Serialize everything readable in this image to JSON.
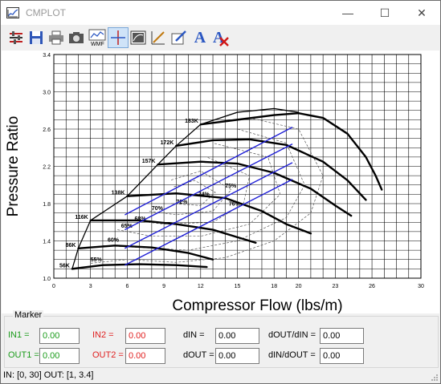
{
  "window": {
    "title": "CMPLOT",
    "minimize": "—",
    "maximize": "☐",
    "close": "✕"
  },
  "toolbar": {
    "items": [
      {
        "name": "settings-icon"
      },
      {
        "name": "save-icon"
      },
      {
        "name": "print-icon"
      },
      {
        "name": "camera-icon"
      },
      {
        "name": "wmf-export-icon",
        "caption": "WMF"
      },
      {
        "name": "crosshair-icon",
        "active": true
      },
      {
        "name": "map-image-icon"
      },
      {
        "name": "line-draw-icon"
      },
      {
        "name": "edit-icon"
      },
      {
        "name": "font-icon",
        "caption": "A"
      },
      {
        "name": "clear-font-icon",
        "caption": "A"
      }
    ]
  },
  "chart_data": {
    "type": "line",
    "xlabel": "Compressor Flow (lbs/m)",
    "ylabel": "Pressure Ratio",
    "xlim": [
      0,
      30
    ],
    "ylim": [
      1.0,
      3.4
    ],
    "x_ticks": [
      "0",
      "3",
      "6",
      "9",
      "12",
      "15",
      "18",
      "20",
      "23",
      "26",
      "30"
    ],
    "y_ticks": [
      "1.0",
      "1.4",
      "1.8",
      "2.2",
      "2.6",
      "3.0",
      "3.4"
    ],
    "grid": true,
    "speed_lines": [
      {
        "label": "56K",
        "points": [
          [
            1.5,
            1.1
          ],
          [
            4,
            1.14
          ],
          [
            7,
            1.15
          ],
          [
            10,
            1.14
          ],
          [
            12.5,
            1.12
          ]
        ]
      },
      {
        "label": "86K",
        "points": [
          [
            2,
            1.32
          ],
          [
            5,
            1.35
          ],
          [
            8,
            1.33
          ],
          [
            11,
            1.27
          ],
          [
            13,
            1.2
          ]
        ]
      },
      {
        "label": "116K",
        "points": [
          [
            3,
            1.62
          ],
          [
            7,
            1.62
          ],
          [
            10,
            1.58
          ],
          [
            13,
            1.52
          ],
          [
            15,
            1.44
          ],
          [
            16.5,
            1.38
          ]
        ]
      },
      {
        "label": "138K",
        "points": [
          [
            6,
            1.88
          ],
          [
            10,
            1.91
          ],
          [
            14,
            1.86
          ],
          [
            17,
            1.72
          ],
          [
            19,
            1.58
          ],
          [
            21,
            1.48
          ]
        ]
      },
      {
        "label": "157K",
        "points": [
          [
            8.5,
            2.22
          ],
          [
            12,
            2.25
          ],
          [
            15,
            2.23
          ],
          [
            18,
            2.13
          ],
          [
            21,
            1.96
          ],
          [
            23,
            1.78
          ],
          [
            24.3,
            1.67
          ]
        ]
      },
      {
        "label": "172K",
        "points": [
          [
            10,
            2.42
          ],
          [
            13,
            2.48
          ],
          [
            16,
            2.49
          ],
          [
            19,
            2.43
          ],
          [
            22,
            2.25
          ],
          [
            24,
            2.05
          ],
          [
            25.5,
            1.84
          ]
        ]
      },
      {
        "label": "183K",
        "points": [
          [
            12,
            2.65
          ],
          [
            15,
            2.7
          ],
          [
            18,
            2.75
          ],
          [
            20,
            2.77
          ],
          [
            22,
            2.72
          ],
          [
            24,
            2.55
          ],
          [
            25.5,
            2.3
          ],
          [
            26.3,
            2.1
          ],
          [
            26.8,
            1.95
          ]
        ]
      }
    ],
    "surge_line": [
      [
        1.5,
        1.1
      ],
      [
        2,
        1.32
      ],
      [
        3,
        1.62
      ],
      [
        6,
        1.88
      ],
      [
        8.5,
        2.22
      ],
      [
        10,
        2.42
      ],
      [
        12,
        2.65
      ],
      [
        15,
        2.78
      ],
      [
        18,
        2.82
      ],
      [
        20,
        2.78
      ]
    ],
    "efficiency_labels": [
      {
        "label": "55%",
        "x": 3.0,
        "y": 1.18
      },
      {
        "label": "60%",
        "x": 4.4,
        "y": 1.39
      },
      {
        "label": "65%",
        "x": 5.5,
        "y": 1.54
      },
      {
        "label": "68%",
        "x": 6.6,
        "y": 1.62
      },
      {
        "label": "70%",
        "x": 8.0,
        "y": 1.73
      },
      {
        "label": "72%",
        "x": 10.0,
        "y": 1.8
      },
      {
        "label": "74%",
        "x": 11.8,
        "y": 1.88
      },
      {
        "label": "75%",
        "x": 14.0,
        "y": 1.97
      },
      {
        "label": "76%",
        "x": 14.3,
        "y": 1.78
      }
    ],
    "marker_lines": [
      {
        "color": "#1f1fd6",
        "points": [
          [
            5.8,
            1.68
          ],
          [
            19.5,
            2.62
          ]
        ]
      },
      {
        "color": "#1f1fd6",
        "points": [
          [
            5.8,
            1.52
          ],
          [
            19.5,
            2.44
          ]
        ]
      },
      {
        "color": "#1f1fd6",
        "points": [
          [
            5.8,
            1.32
          ],
          [
            19.5,
            2.24
          ]
        ]
      },
      {
        "color": "#1f1fd6",
        "points": [
          [
            5.8,
            1.14
          ],
          [
            19.5,
            2.06
          ]
        ]
      }
    ]
  },
  "marker": {
    "title": "Marker",
    "in1": {
      "label": "IN1 =",
      "value": "0.00"
    },
    "in2": {
      "label": "IN2 =",
      "value": "0.00"
    },
    "din": {
      "label": "dIN =",
      "value": "0.00"
    },
    "dout_din": {
      "label": "dOUT/dIN =",
      "value": "0.00"
    },
    "out1": {
      "label": "OUT1 =",
      "value": "0.00"
    },
    "out2": {
      "label": "OUT2 =",
      "value": "0.00"
    },
    "dout": {
      "label": "dOUT =",
      "value": "0.00"
    },
    "din_dout": {
      "label": "dIN/dOUT =",
      "value": "0.00"
    }
  },
  "status": {
    "text": "IN: [0,  30]   OUT: [1,  3.4]"
  }
}
